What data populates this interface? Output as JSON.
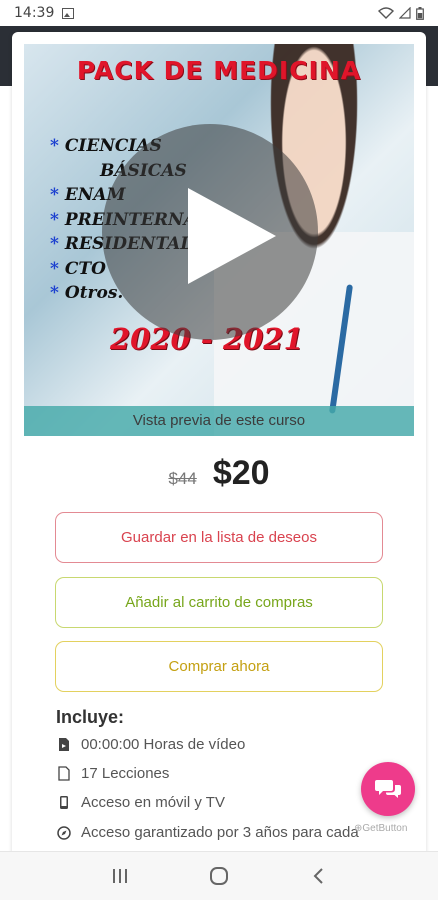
{
  "status": {
    "time": "14:39"
  },
  "course": {
    "preview": {
      "title": "PACK DE MEDICINA",
      "topics": [
        "CIENCIAS",
        "BÁSICAS",
        "ENAM",
        "PREINTERNADO",
        "RESIDENTADO",
        "CTO",
        "Otros."
      ],
      "years": "2020 - 2021",
      "preview_label": "Vista previa de este curso"
    },
    "old_price": "$44",
    "price": "$20"
  },
  "buttons": {
    "wishlist": "Guardar en la lista de deseos",
    "cart": "Añadir al carrito de compras",
    "buy": "Comprar ahora"
  },
  "includes": {
    "title": "Incluye:",
    "items": [
      {
        "icon": "video-file-icon",
        "text": "00:00:00 Horas de vídeo"
      },
      {
        "icon": "document-icon",
        "text": "17 Lecciones"
      },
      {
        "icon": "mobile-icon",
        "text": "Acceso en móvil y TV"
      },
      {
        "icon": "compass-icon",
        "text": "Acceso garantizado por 3 años para cada"
      }
    ]
  },
  "getbutton_label": "GetButton",
  "colors": {
    "title_red": "#e0152a",
    "topic_star": "#1b3fd0",
    "wishlist_text": "#d9434f",
    "cart_text": "#77a61b",
    "buy_text": "#c4a012",
    "fab": "#ee3b8b",
    "preview_bar": "#45aaaa"
  }
}
